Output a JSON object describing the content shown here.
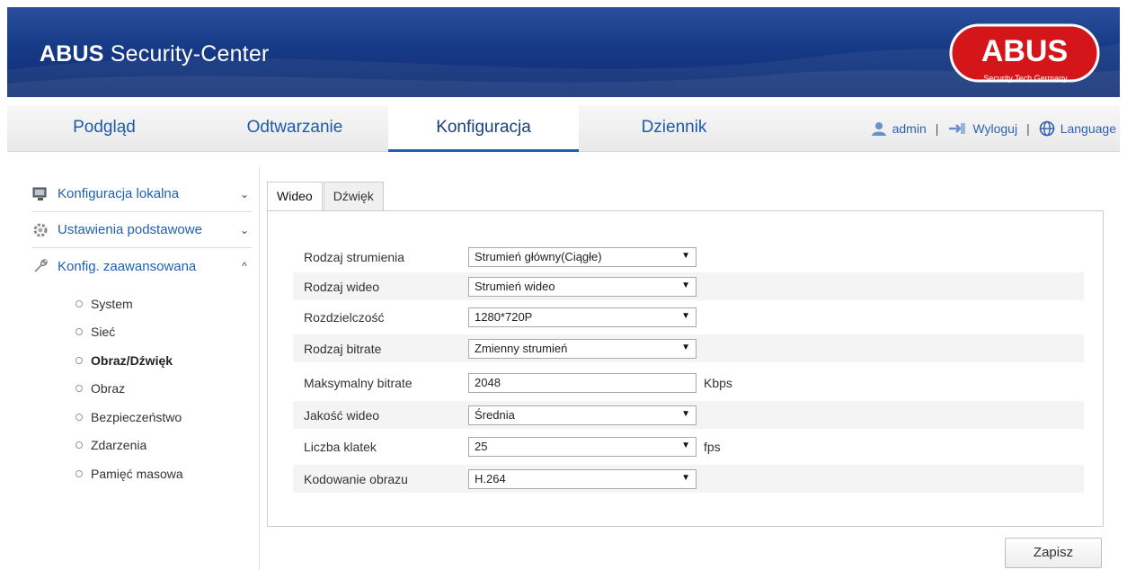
{
  "header": {
    "title_bold": "ABUS",
    "title_rest": " Security-Center",
    "logo_text": "ABUS",
    "logo_tagline": "Security Tech Germany"
  },
  "nav": {
    "tabs": [
      {
        "label": "Podgląd"
      },
      {
        "label": "Odtwarzanie"
      },
      {
        "label": "Konfiguracja"
      },
      {
        "label": "Dziennik"
      }
    ],
    "active_tab": "Konfiguracja",
    "user": "admin",
    "logout": "Wyloguj",
    "language": "Language",
    "separator": "|"
  },
  "sidebar": {
    "sections": [
      {
        "label": "Konfiguracja lokalna",
        "chevron": "⌄",
        "icon": "monitor-icon"
      },
      {
        "label": "Ustawienia podstawowe",
        "chevron": "⌄",
        "icon": "gear-icon"
      },
      {
        "label": "Konfig. zaawansowana",
        "chevron": "^",
        "icon": "wrench-icon"
      }
    ],
    "items": [
      {
        "label": "System"
      },
      {
        "label": "Sieć"
      },
      {
        "label": "Obraz/Dźwięk"
      },
      {
        "label": "Obraz"
      },
      {
        "label": "Bezpieczeństwo"
      },
      {
        "label": "Zdarzenia"
      },
      {
        "label": "Pamięć masowa"
      }
    ],
    "active_item": "Obraz/Dźwięk"
  },
  "content": {
    "tabs": [
      {
        "label": "Wideo"
      },
      {
        "label": "Dźwięk"
      }
    ],
    "active_tab": "Wideo",
    "fields": [
      {
        "label": "Rodzaj strumienia",
        "type": "select",
        "value": "Strumień główny(Ciągłe)",
        "unit": ""
      },
      {
        "label": "Rodzaj wideo",
        "type": "select",
        "value": "Strumień wideo",
        "unit": ""
      },
      {
        "label": "Rozdzielczość",
        "type": "select",
        "value": "1280*720P",
        "unit": ""
      },
      {
        "label": "Rodzaj bitrate",
        "type": "select",
        "value": "Zmienny strumień",
        "unit": ""
      },
      {
        "label": "Maksymalny bitrate",
        "type": "input",
        "value": "2048",
        "unit": "Kbps"
      },
      {
        "label": "Jakość wideo",
        "type": "select",
        "value": "Średnia",
        "unit": ""
      },
      {
        "label": "Liczba klatek",
        "type": "select",
        "value": "25",
        "unit": "fps"
      },
      {
        "label": "Kodowanie obrazu",
        "type": "select",
        "value": "H.264",
        "unit": ""
      }
    ],
    "save_label": "Zapisz"
  },
  "colors": {
    "header_blue": "#173a86",
    "link_blue": "#1f5fb0",
    "logo_red": "#d4161b"
  }
}
